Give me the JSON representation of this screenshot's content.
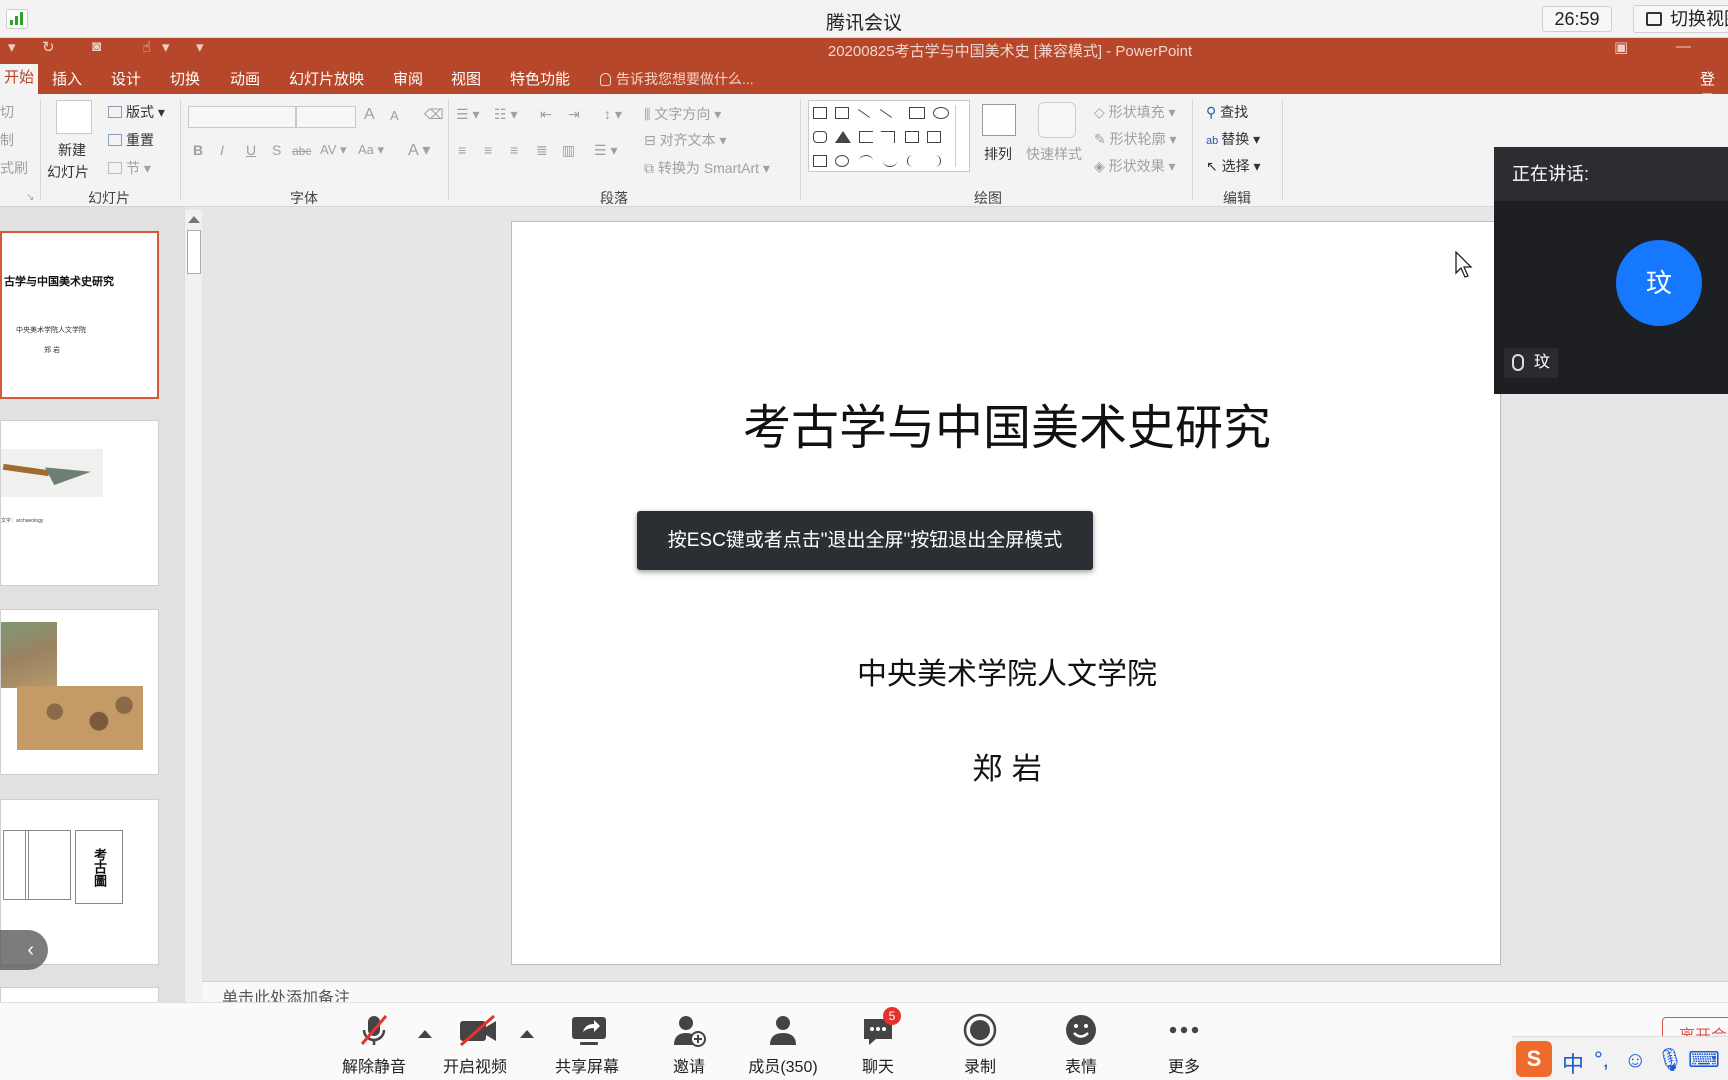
{
  "meeting": {
    "app_title": "腾讯会议",
    "timer": "26:59",
    "switch_view": "切换视图",
    "speaker_header": "正在讲话:",
    "speaker_avatar": "玟",
    "speaker_name": "玟",
    "esc_tip": "按ESC键或者点击\"退出全屏\"按钮退出全屏模式",
    "toolbar": {
      "unmute": "解除静音",
      "start_video": "开启视频",
      "share_screen": "共享屏幕",
      "invite": "邀请",
      "members": "成员(350)",
      "chat": "聊天",
      "chat_badge": "5",
      "record": "录制",
      "emoji": "表情",
      "more": "更多",
      "leave": "离开会议"
    }
  },
  "ppt": {
    "doc_title": "20200825考古学与中国美术史 [兼容模式] - PowerPoint",
    "tabs": {
      "home": "开始",
      "insert": "插入",
      "design": "设计",
      "transitions": "切换",
      "animations": "动画",
      "slideshow": "幻灯片放映",
      "review": "审阅",
      "view": "视图",
      "special": "特色功能"
    },
    "tell_me": "告诉我您想要做什么...",
    "login": "登录",
    "ribbon": {
      "cut": "切",
      "copy": "制",
      "format_painter": "式刷",
      "new_slide_1": "新建",
      "new_slide_2": "幻灯片",
      "layout": "版式",
      "reset": "重置",
      "section": "节",
      "group_slides": "幻灯片",
      "group_font": "字体",
      "group_paragraph": "段落",
      "text_direction": "文字方向",
      "align_text": "对齐文本",
      "convert_smartart": "转换为 SmartArt",
      "arrange": "排列",
      "quick_styles": "快速样式",
      "shape_fill": "形状填充",
      "shape_outline": "形状轮廓",
      "shape_effects": "形状效果",
      "group_drawing": "绘图",
      "find": "查找",
      "replace": "替换",
      "select": "选择",
      "group_editing": "编辑"
    },
    "thumbs": {
      "t1_title": "古学与中国美术史研究",
      "t1_sub": "中央美术学院人文学院",
      "t1_author": "郑 岩",
      "t2_caption": "文字：archaeology",
      "t4_text": "考古圖"
    },
    "slide": {
      "title": "考古学与中国美术史研究",
      "institution": "中央美术学院人文学院",
      "author": "郑 岩"
    },
    "notes_placeholder": "单击此处添加备注"
  }
}
